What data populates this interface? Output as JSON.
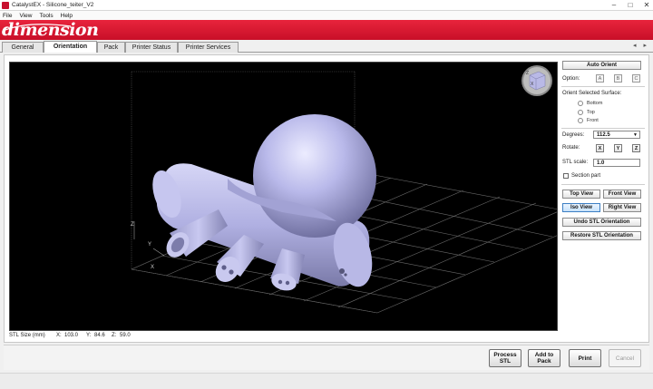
{
  "window": {
    "title": "CatalystEX - Silicone_teiter_V2",
    "minimize": "–",
    "maximize": "□",
    "close": "✕"
  },
  "menu": [
    "File",
    "View",
    "Tools",
    "Help"
  ],
  "brand": {
    "logo_text": "dimension",
    "color": "#c8102e"
  },
  "tabs": [
    {
      "label": "General"
    },
    {
      "label": "Orientation",
      "active": true
    },
    {
      "label": "Pack"
    },
    {
      "label": "Printer Status"
    },
    {
      "label": "Printer Services"
    }
  ],
  "tab_scroll": "◂ ▸",
  "viewport": {
    "axes": {
      "z": "Z",
      "y": "Y",
      "x": "X"
    },
    "cube_axes": {
      "z": "Z",
      "x": "X"
    },
    "model_color": "#b3b3e6",
    "background": "#000000"
  },
  "stl_size": {
    "label": "STL Size (mm)",
    "x_label": "X:",
    "x": "103.0",
    "y_label": "Y:",
    "y": "84.6",
    "z_label": "Z:",
    "z": "59.0"
  },
  "panel": {
    "auto_orient": "Auto Orient",
    "option_label": "Option:",
    "options": [
      "A",
      "B",
      "C"
    ],
    "orient_surface_label": "Orient Selected Surface:",
    "surfaces": [
      "Bottom",
      "Top",
      "Front"
    ],
    "degrees_label": "Degrees:",
    "degrees_value": "112.5",
    "rotate_label": "Rotate:",
    "rotate_axes": [
      "X",
      "Y",
      "Z"
    ],
    "stl_scale_label": "STL scale:",
    "stl_scale_value": "1.0",
    "section_part": "Section part",
    "top_view": "Top View",
    "front_view": "Front View",
    "iso_view": "Iso View",
    "right_view": "Right View",
    "undo_orientation": "Undo STL Orientation",
    "restore_orientation": "Restore STL Orientation"
  },
  "actions": {
    "process_stl": [
      "Process",
      "STL"
    ],
    "add_to_pack": [
      "Add to",
      "Pack"
    ],
    "print": "Print",
    "cancel": "Cancel"
  }
}
